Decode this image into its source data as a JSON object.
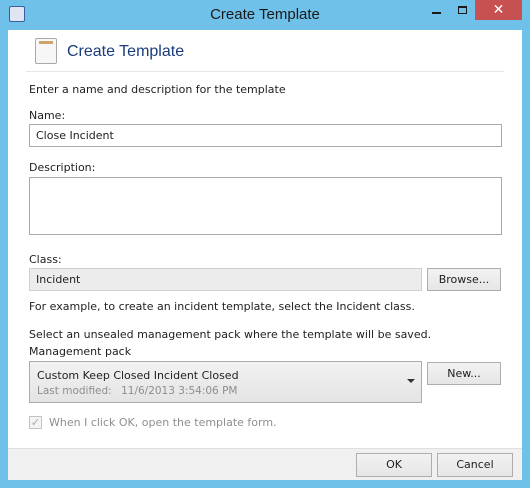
{
  "window": {
    "title": "Create Template"
  },
  "header": {
    "title": "Create Template",
    "intro": "Enter a name and description for the template"
  },
  "form": {
    "name_label": "Name:",
    "name_value": "Close Incident",
    "description_label": "Description:",
    "description_value": "",
    "class_label": "Class:",
    "class_value": "Incident",
    "browse_label": "Browse...",
    "class_hint": "For example, to create an incident template, select the Incident class.",
    "mp_instruction": "Select an unsealed management pack where the template will be saved.",
    "mp_label": "Management pack",
    "mp_selected": "Custom Keep Closed Incident Closed",
    "mp_last_modified_label": "Last modified:",
    "mp_last_modified_value": "11/6/2013 3:54:06 PM",
    "new_label": "New...",
    "open_form_label": "When I click OK, open the template form.",
    "open_form_checked": true,
    "open_form_enabled": false
  },
  "footer": {
    "ok_label": "OK",
    "cancel_label": "Cancel"
  },
  "icons": {
    "app": "settings-app-icon",
    "header": "template-icon",
    "minimize": "minimize-icon",
    "maximize": "maximize-icon",
    "close": "close-icon",
    "dropdown": "chevron-down-icon",
    "check": "checkmark-icon"
  },
  "colors": {
    "window_border": "#6fc1ea",
    "close_button": "#c75050",
    "header_title": "#1a3b7d"
  }
}
